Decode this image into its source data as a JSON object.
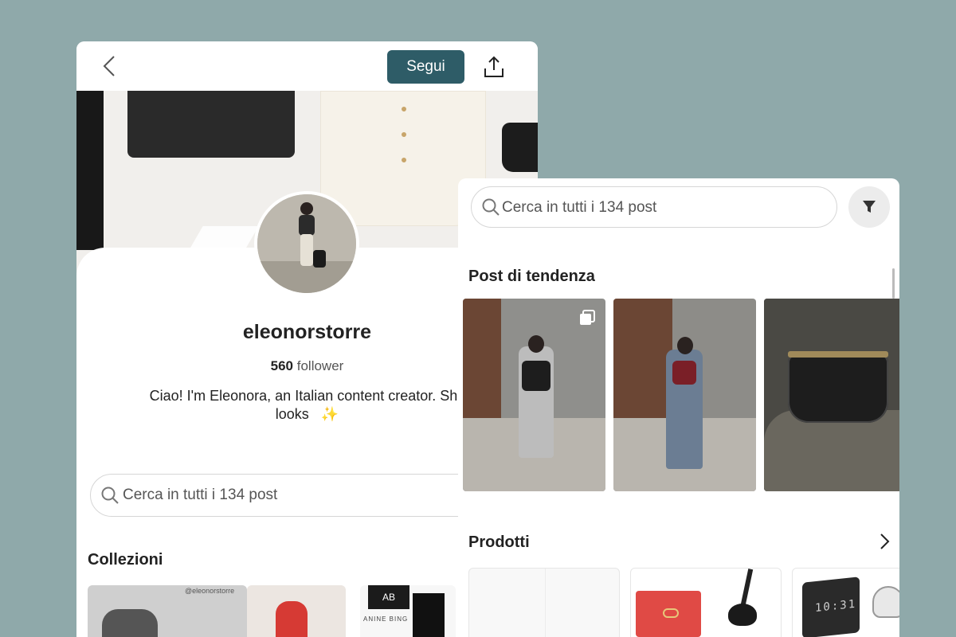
{
  "profile": {
    "follow_label": "Segui",
    "username": "eleonorstorre",
    "followers_count": "560",
    "followers_label": "follower",
    "bio_line1": "Ciao! I'm Eleonora, an Italian content creator. She",
    "bio_line2": "looks",
    "sparkle": "✨",
    "search_placeholder": "Cerca in tutti i 134 post",
    "collections_title": "Collezioni",
    "collection_tag": "@eleonorstorre",
    "collection_brand_logo": "AB",
    "collection_brand": "ANINE BING"
  },
  "detail": {
    "search_placeholder": "Cerca in tutti i 134 post",
    "trending_title": "Post di tendenza",
    "products_title": "Prodotti",
    "clock_display": "10:31"
  },
  "colors": {
    "background": "#8fa9aa",
    "follow_button": "#2e5c67"
  },
  "icons": [
    "chevron-left-icon",
    "share-icon",
    "search-icon",
    "filter-icon",
    "multiple-photos-icon",
    "chevron-right-icon",
    "sparkles-icon"
  ]
}
